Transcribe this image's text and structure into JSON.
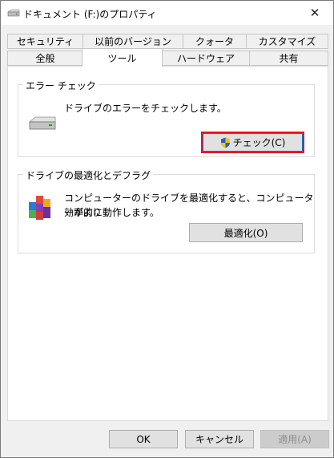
{
  "window": {
    "title": "ドキュメント (F:)のプロパティ",
    "close_symbol": "✕"
  },
  "tabs": {
    "row1": [
      "セキュリティ",
      "以前のバージョン",
      "クォータ",
      "カスタマイズ"
    ],
    "row2": [
      "全般",
      "ツール",
      "ハードウェア",
      "共有"
    ],
    "active": "ツール"
  },
  "error_check": {
    "group_label": "エラー チェック",
    "description": "ドライブのエラーをチェックします。",
    "button_label": "チェック(C)",
    "icon": "drive-icon",
    "button_icon": "uac-shield-icon"
  },
  "optimize": {
    "group_label": "ドライブの最適化とデフラグ",
    "description_line1": "コンピューターのドライブを最適化すると、コンピューターがより",
    "description_line2": "効率的に動作します。",
    "button_label": "最適化(O)",
    "icon": "defrag-icon"
  },
  "footer": {
    "ok_label": "OK",
    "cancel_label": "キャンセル",
    "apply_label": "適用(A)"
  },
  "colors": {
    "focus_highlight": "#e81123",
    "panel_bg": "#ffffff",
    "dialog_bg": "#f0f0f0"
  }
}
